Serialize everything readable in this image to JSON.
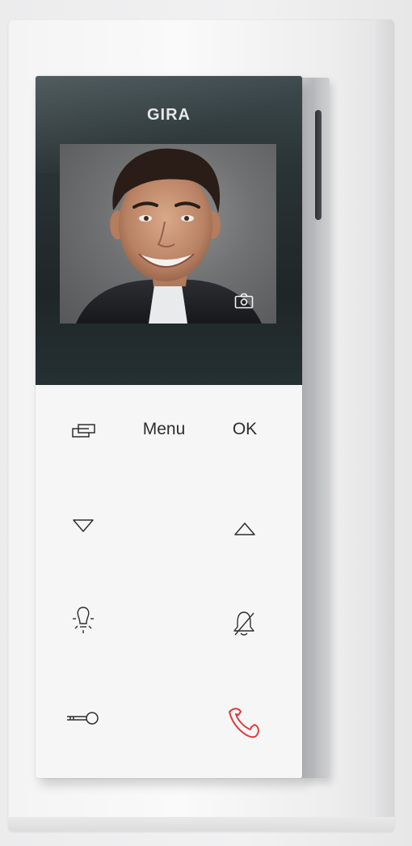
{
  "device": {
    "brand": "GIRA",
    "keys": {
      "menu_label": "Menu",
      "ok_label": "OK"
    },
    "icons": {
      "video": "camera-icon",
      "screens": "screens-icon",
      "down": "arrow-down-icon",
      "up": "arrow-up-icon",
      "light": "light-bulb-icon",
      "mute": "bell-mute-icon",
      "door": "key-icon",
      "call": "phone-handset-icon"
    },
    "colors": {
      "panel": "#1f2628",
      "body": "#f6f6f7",
      "icon": "#2c2e30",
      "call": "#e03a3a",
      "brand_text": "#e6e8e8"
    }
  }
}
